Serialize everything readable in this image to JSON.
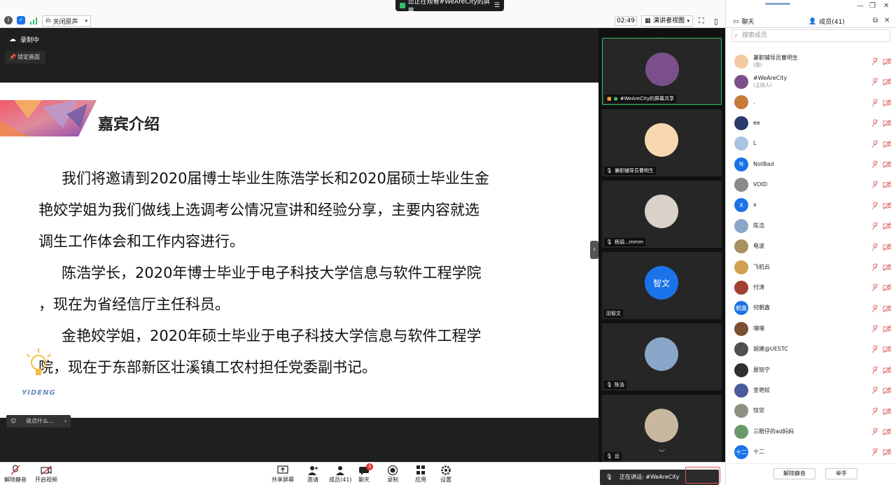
{
  "topbar": {
    "mute_original": "关闭原声",
    "watching": "您正在观看#WeAreCity的屏幕",
    "timer": "02:49",
    "view_mode": "演讲者视图"
  },
  "stage": {
    "recording": "录制中",
    "lock_view": "锁定画面",
    "chat_placeholder": "说点什么...",
    "slide": {
      "title": "嘉宾介绍",
      "paragraphs": [
        "我们将邀请到2020届博士毕业生陈浩学长和2020届硕士毕业生金",
        "艳姣学姐为我们做线上选调考公情况宣讲和经验分享，主要内容就选",
        "调生工作体会和工作内容进行。",
        "陈浩学长，2020年博士毕业于电子科技大学信息与软件工程学院",
        "，现在为省经信厅主任科员。",
        "金艳姣学姐，2020年硕士毕业于电子科技大学信息与软件工程学",
        "院，现在于东部新区壮溪镇工农村担任党委副书记。"
      ],
      "logo_text": "YIDENG"
    }
  },
  "video_tiles": [
    {
      "name": "#WeAreCity的屏幕共享",
      "avatar_color": "#7a4f8a"
    },
    {
      "name": "兼职辅导员曹明生",
      "avatar_color": "#f7d7b0"
    },
    {
      "name": "杨调...mmm",
      "avatar_color": "#d8d2c8"
    },
    {
      "name": "田智文",
      "avatar_text": "智文",
      "avatar_color": "#1a73e8"
    },
    {
      "name": "陈浩",
      "avatar_color": "#8aa6c8"
    },
    {
      "name": "远",
      "avatar_color": "#c9b8a0"
    }
  ],
  "panel": {
    "chat_tab": "聊天",
    "members_tab": "成员(41)",
    "search_placeholder": "搜索成员",
    "members": [
      {
        "name": "兼职辅导员曹明生",
        "sub": "(我)",
        "color": "#f2c9a0"
      },
      {
        "name": "#WeAreCity",
        "sub": "(主持人)",
        "color": "#7a4f8a"
      },
      {
        "name": ".",
        "sub": "",
        "color": "#c87a3a"
      },
      {
        "name": "ee",
        "sub": "",
        "color": "#2a3a6a"
      },
      {
        "name": "L",
        "sub": "",
        "color": "#a8c4e0"
      },
      {
        "name": "NotBad",
        "sub": "",
        "initial": "N",
        "color": "#1a73e8"
      },
      {
        "name": "VOID",
        "sub": "",
        "color": "#8a8a8a"
      },
      {
        "name": "x",
        "sub": "",
        "initial": "X",
        "color": "#1a73e8"
      },
      {
        "name": "陈浩",
        "sub": "",
        "color": "#8aa6c8"
      },
      {
        "name": "电波",
        "sub": "",
        "color": "#a89060"
      },
      {
        "name": "飞机云",
        "sub": "",
        "color": "#d0a050"
      },
      {
        "name": "付涛",
        "sub": "",
        "color": "#a04030"
      },
      {
        "name": "何朝鑫",
        "sub": "",
        "initial": "朝鑫",
        "color": "#1a73e8"
      },
      {
        "name": "嘿嘿",
        "sub": "",
        "color": "#7a5030"
      },
      {
        "name": "胡建@UESTC",
        "sub": "",
        "color": "#505050"
      },
      {
        "name": "扈铭宁",
        "sub": "",
        "color": "#303030"
      },
      {
        "name": "金艳姣",
        "sub": "",
        "color": "#4a5a9a"
      },
      {
        "name": "惊觉",
        "sub": "",
        "color": "#909080"
      },
      {
        "name": "三眼仔的ad妈妈",
        "sub": "",
        "color": "#6a9a6a"
      },
      {
        "name": "十二",
        "sub": "",
        "initial": "十二",
        "color": "#1a73e8"
      }
    ],
    "unmute_all": "解除静音",
    "raise_hand": "举手"
  },
  "toolbar": {
    "unmute": "解除静音",
    "start_video": "开启视频",
    "share_screen": "共享屏幕",
    "invite": "邀请",
    "members": "成员(41)",
    "chat": "聊天",
    "chat_badge": "3",
    "record": "录制",
    "apps": "应用",
    "settings": "设置",
    "speaking": "正在讲话: #WeAreCity"
  }
}
